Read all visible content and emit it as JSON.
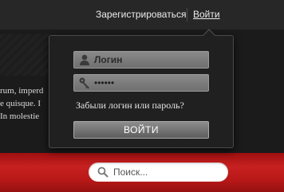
{
  "header": {
    "register_label": "Зарегистрироваться",
    "login_label": "Войти"
  },
  "background_text": {
    "lines": [
      "rum, imperd",
      "e quisque. I",
      "In molestie"
    ]
  },
  "login_popup": {
    "login_placeholder": "Логин",
    "password_value": "••••••",
    "forgot_label": "Забыли логин или пароль?",
    "submit_label": "ВОЙТИ",
    "icons": {
      "login": "user-icon",
      "password": "key-icon"
    }
  },
  "search": {
    "placeholder": "Поиск...",
    "icon": "search-icon"
  },
  "colors": {
    "accent_red": "#c72020",
    "popup_bg": "#202020",
    "text_light": "#ececec"
  }
}
